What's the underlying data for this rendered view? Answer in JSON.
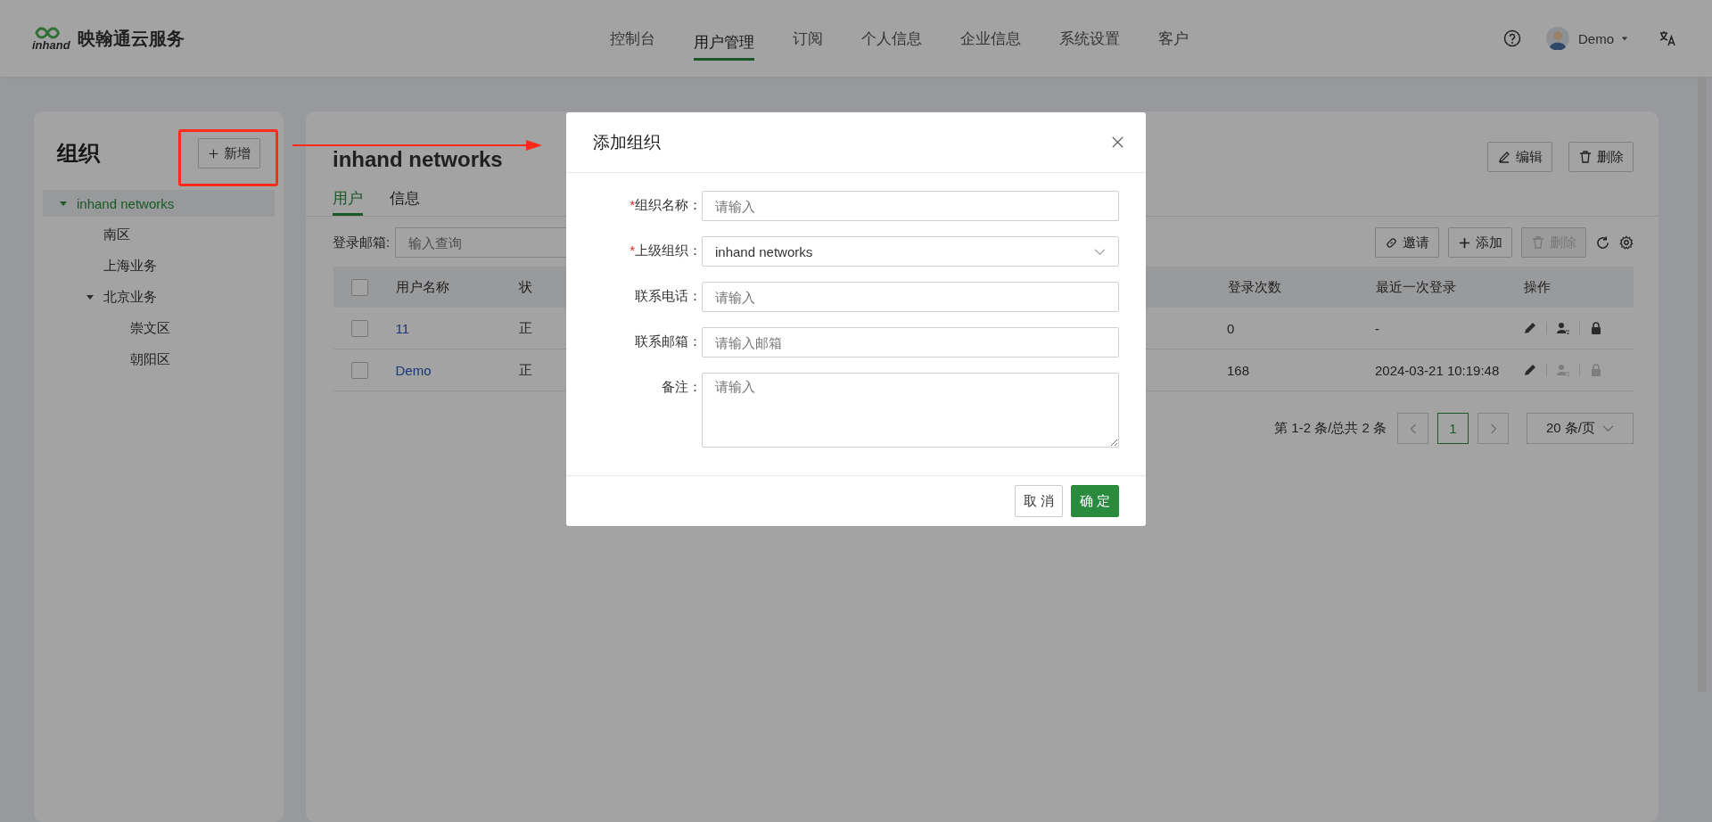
{
  "header": {
    "logo_text": "inhand",
    "brand": "映翰通云服务",
    "nav": [
      {
        "label": "控制台",
        "selected": false
      },
      {
        "label": "用户管理",
        "selected": true
      },
      {
        "label": "订阅",
        "selected": false
      },
      {
        "label": "个人信息",
        "selected": false
      },
      {
        "label": "企业信息",
        "selected": false
      },
      {
        "label": "系统设置",
        "selected": false
      },
      {
        "label": "客户",
        "selected": false
      }
    ],
    "user": {
      "name": "Demo"
    }
  },
  "sidebar": {
    "title": "组织",
    "add_button": "新增",
    "tree": [
      {
        "label": "inhand networks",
        "selected": true,
        "expanded": true,
        "children": [
          {
            "label": "南区",
            "selected": false
          },
          {
            "label": "上海业务",
            "selected": false
          },
          {
            "label": "北京业务",
            "selected": false,
            "expanded": true,
            "children": [
              {
                "label": "崇文区",
                "selected": false
              },
              {
                "label": "朝阳区",
                "selected": false
              }
            ]
          }
        ]
      }
    ]
  },
  "main": {
    "title": "inhand networks",
    "actions": [
      {
        "label": "编辑",
        "kind": "edit"
      },
      {
        "label": "删除",
        "kind": "delete"
      }
    ],
    "tabs": [
      {
        "label": "用户",
        "selected": true
      },
      {
        "label": "信息",
        "selected": false
      }
    ],
    "filter": {
      "label": "登录邮箱:",
      "placeholder": "输入查询"
    },
    "toolbar": [
      {
        "label": "邀请",
        "kind": "invite",
        "disabled": false
      },
      {
        "label": "添加",
        "kind": "add",
        "disabled": false
      },
      {
        "label": "删除",
        "kind": "delete",
        "disabled": true
      }
    ],
    "table": {
      "header_checked": false,
      "columns": [
        "用户名称",
        "状",
        "登录次数",
        "最近一次登录",
        "操作"
      ],
      "rows": [
        {
          "checked": false,
          "name": "11",
          "status": "正",
          "logins": "0",
          "last_login": "-",
          "actions": [
            {
              "kind": "edit",
              "disabled": false
            },
            {
              "kind": "transfer",
              "disabled": false
            },
            {
              "kind": "lock",
              "disabled": false
            }
          ]
        },
        {
          "checked": false,
          "name": "Demo",
          "status": "正",
          "logins": "168",
          "last_login": "2024-03-21 10:19:48",
          "actions": [
            {
              "kind": "edit",
              "disabled": false
            },
            {
              "kind": "transfer",
              "disabled": true
            },
            {
              "kind": "lock",
              "disabled": true
            }
          ]
        }
      ]
    },
    "pagination": {
      "summary": "第 1-2 条/总共 2 条",
      "pages": [
        {
          "label": "1",
          "selected": true
        }
      ],
      "page_size": "20 条/页"
    }
  },
  "modal": {
    "title": "添加组织",
    "required_mark": "*",
    "fields": [
      {
        "label": "组织名称：",
        "required": true,
        "kind": "text",
        "placeholder": "请输入"
      },
      {
        "label": "上级组织：",
        "required": true,
        "kind": "select",
        "value": "inhand networks"
      },
      {
        "label": "联系电话：",
        "required": false,
        "kind": "text",
        "placeholder": "请输入"
      },
      {
        "label": "联系邮箱：",
        "required": false,
        "kind": "text",
        "placeholder": "请输入邮箱"
      },
      {
        "label": "备注：",
        "required": false,
        "kind": "textarea",
        "placeholder": "请输入"
      }
    ],
    "buttons": [
      {
        "label": "取 消",
        "kind": "secondary"
      },
      {
        "label": "确 定",
        "kind": "primary"
      }
    ]
  }
}
